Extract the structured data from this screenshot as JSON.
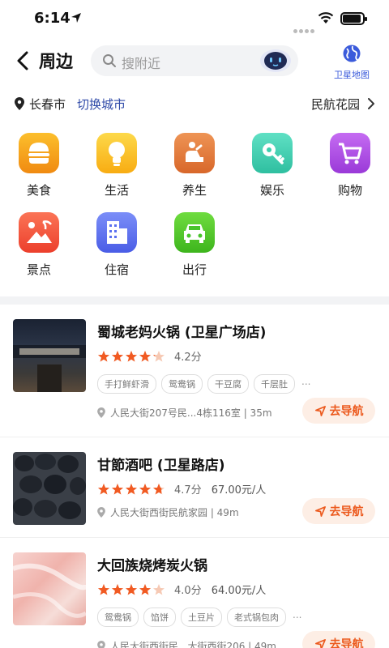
{
  "status": {
    "time": "6:14"
  },
  "header": {
    "title": "周边",
    "search_placeholder": "搜附近",
    "satellite_label": "卫星地图"
  },
  "location": {
    "city": "长春市",
    "switch_label": "切换城市",
    "area": "民航花园"
  },
  "categories": [
    {
      "label": "美食",
      "icon": "burger-icon",
      "color": "#f7a21b"
    },
    {
      "label": "生活",
      "icon": "lightbulb-icon",
      "color": "#fbbf20"
    },
    {
      "label": "养生",
      "icon": "massage-icon",
      "color": "#e27a3a"
    },
    {
      "label": "娱乐",
      "icon": "key-icon",
      "color": "#3fd0b0"
    },
    {
      "label": "购物",
      "icon": "cart-icon",
      "color": "#b04ce6"
    },
    {
      "label": "景点",
      "icon": "palm-tree-icon",
      "color": "#f5533d"
    },
    {
      "label": "住宿",
      "icon": "building-icon",
      "color": "#5a6ff0"
    },
    {
      "label": "出行",
      "icon": "car-icon",
      "color": "#49c42c"
    }
  ],
  "results": [
    {
      "name": "蜀城老妈火锅 (卫星广场店)",
      "rating": 4.2,
      "score": "4.2分",
      "price": "",
      "tags": [
        "手打鲜虾滑",
        "鸳鸯锅",
        "干豆腐",
        "千层肚"
      ],
      "tags_more": "...",
      "address": "人民大街207号民...4栋116室 | 35m",
      "nav_label": "去导航"
    },
    {
      "name": "甘節酒吧 (卫星路店)",
      "rating": 4.7,
      "score": "4.7分",
      "price": "67.00元/人",
      "tags": [],
      "tags_more": "",
      "address": "人民大街西街民航家园 | 49m",
      "nav_label": "去导航"
    },
    {
      "name": "大回族烧烤炭火锅",
      "rating": 4.0,
      "score": "4.0分",
      "price": "64.00元/人",
      "tags": [
        "鸳鸯锅",
        "馅饼",
        "土豆片",
        "老式锅包肉"
      ],
      "tags_more": "...",
      "address": "人民大街西街民...大街西街206 | 49m",
      "nav_label": "去导航"
    }
  ],
  "colors": {
    "accent": "#ec5a1e",
    "star": "#f15a22",
    "link": "#2f4aa8"
  }
}
